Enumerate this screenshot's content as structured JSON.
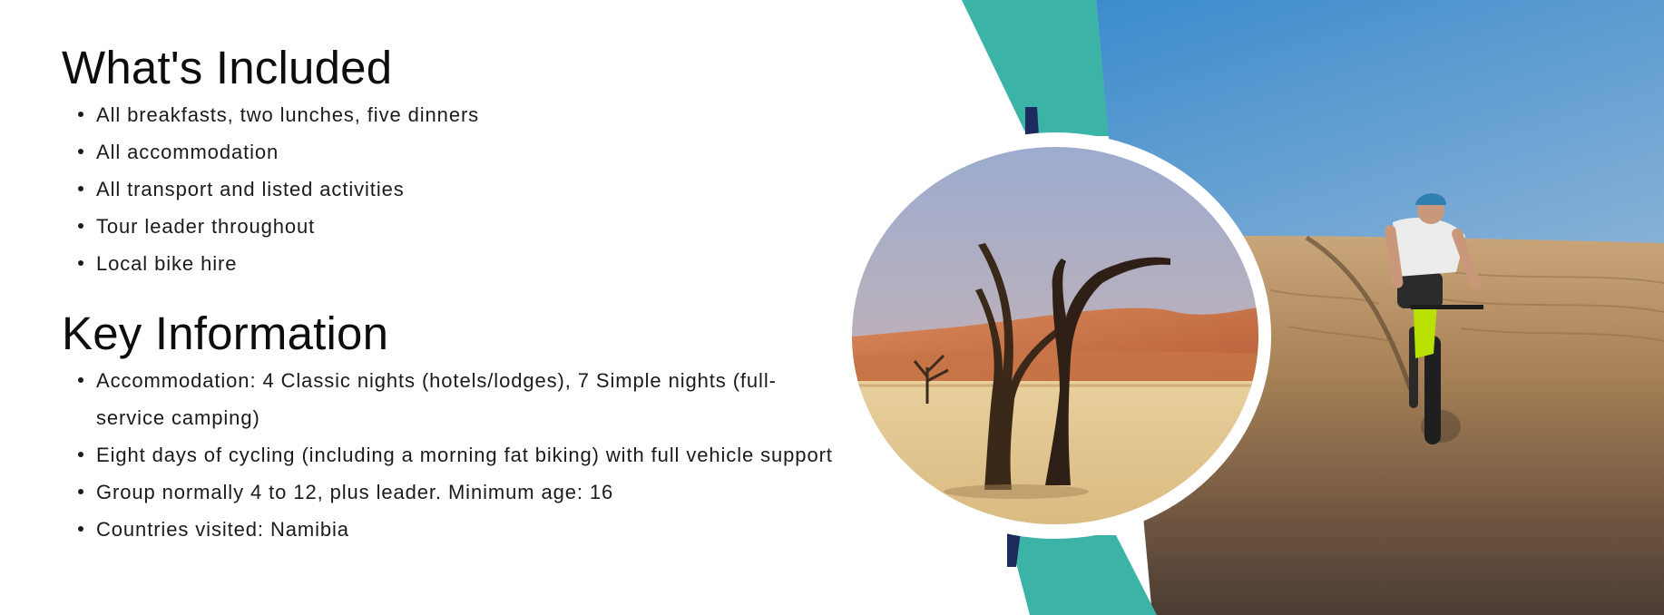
{
  "sections": [
    {
      "title": "What's Included",
      "items": [
        "All breakfasts, two lunches, five dinners",
        "All accommodation",
        "All transport and listed activities",
        "Tour leader throughout",
        "Local bike hire"
      ]
    },
    {
      "title": "Key Information",
      "items": [
        "Accommodation: 4 Classic nights (hotels/lodges), 7 Simple nights (full-service camping)",
        "Eight days of cycling (including a morning fat biking) with full vehicle support",
        "Group normally 4 to 12, plus leader. Minimum age: 16",
        "Countries visited: Namibia"
      ]
    }
  ],
  "colors": {
    "accent_teal": "#3bb3a6",
    "accent_navy": "#1c2c5e",
    "sky_top": "#3d8ccc",
    "sand": "#b89466"
  },
  "images": {
    "circle_photo": "deadvlei-dead-trees-photo",
    "background_photo": "fat-bike-cyclist-on-dune-photo"
  }
}
